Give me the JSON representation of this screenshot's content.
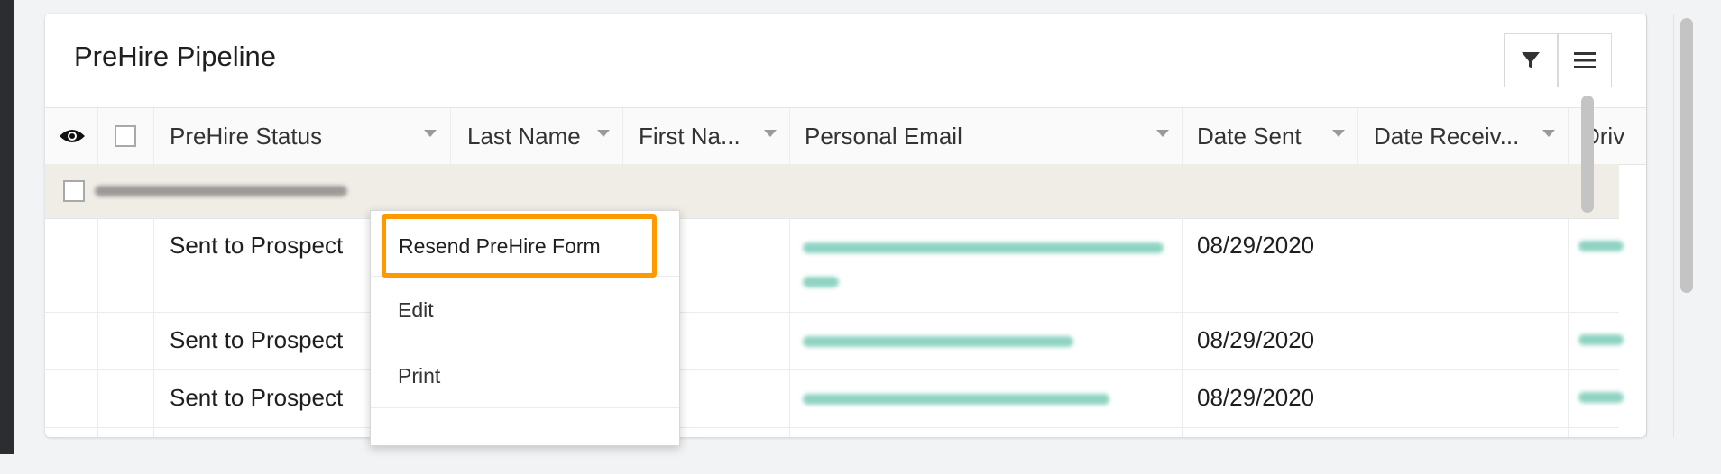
{
  "panel": {
    "title": "PreHire Pipeline",
    "toolbar": [
      "filter-icon",
      "menu-icon"
    ]
  },
  "grid": {
    "columns": [
      "PreHire Status",
      "Last Name",
      "First Na...",
      "Personal Email",
      "Date Sent",
      "Date Receiv...",
      "Driv"
    ],
    "rows": [
      {
        "status": "Sent to Prospect",
        "date_sent": "08/29/2020"
      },
      {
        "status": "Sent to Prospect",
        "date_sent": "08/29/2020"
      },
      {
        "status": "Sent to Prospect",
        "date_sent": "08/29/2020"
      }
    ]
  },
  "context_menu": {
    "items": [
      "Resend PreHire Form",
      "Edit",
      "Print"
    ]
  },
  "colors": {
    "highlight": "#ff9900",
    "group_row_bg": "#f0ece6",
    "redacted_email": "#8fd3c2"
  }
}
